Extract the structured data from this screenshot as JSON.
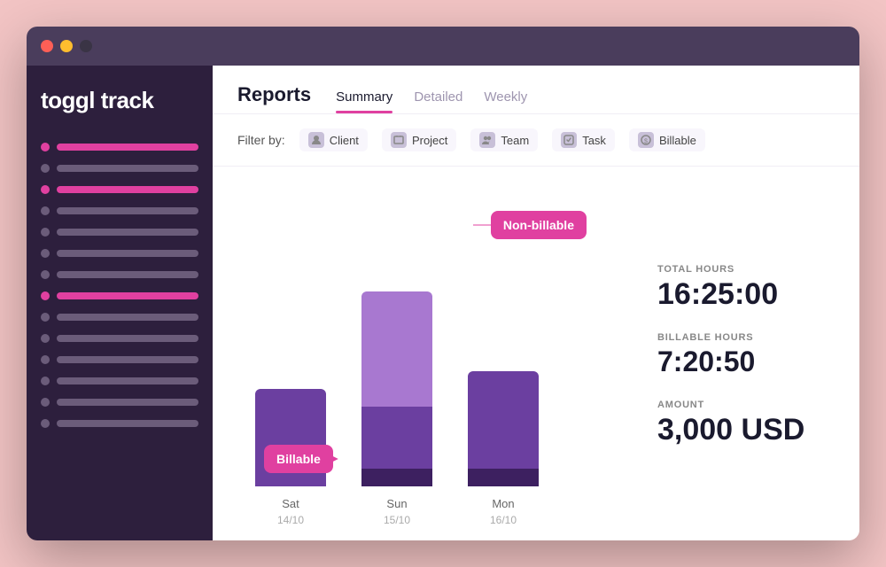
{
  "window": {
    "titlebar": {
      "btn_close": "close",
      "btn_min": "minimize",
      "btn_max": "maximize"
    }
  },
  "sidebar": {
    "logo_text1": "toggl",
    "logo_text2": " track",
    "items": [
      {
        "dot": "pink",
        "bar": "pink-long"
      },
      {
        "dot": "gray",
        "bar": "gray-xl"
      },
      {
        "dot": "pink",
        "bar": "pink-short"
      },
      {
        "dot": "gray",
        "bar": "gray-lg"
      },
      {
        "dot": "gray",
        "bar": "gray-md"
      },
      {
        "dot": "gray",
        "bar": "gray-sm"
      },
      {
        "dot": "gray",
        "bar": "gray-xs"
      },
      {
        "dot": "pink",
        "bar": "pink-short"
      },
      {
        "dot": "gray",
        "bar": "gray-xl"
      },
      {
        "dot": "gray",
        "bar": "gray-md"
      },
      {
        "dot": "gray",
        "bar": "gray-sm"
      },
      {
        "dot": "gray",
        "bar": "gray-lg"
      },
      {
        "dot": "gray",
        "bar": "gray-xs"
      },
      {
        "dot": "gray",
        "bar": "gray-md"
      }
    ]
  },
  "header": {
    "title": "Reports",
    "tabs": [
      {
        "label": "Summary",
        "active": true
      },
      {
        "label": "Detailed",
        "active": false
      },
      {
        "label": "Weekly",
        "active": false
      }
    ]
  },
  "filterbar": {
    "label": "Filter by:",
    "filters": [
      {
        "label": "Client",
        "icon": "👤"
      },
      {
        "label": "Project",
        "icon": "🗂"
      },
      {
        "label": "Team",
        "icon": "👥"
      },
      {
        "label": "Task",
        "icon": "✓"
      },
      {
        "label": "Billable",
        "icon": "$"
      }
    ]
  },
  "chart": {
    "bars": [
      {
        "day": "Sat",
        "date": "14/10",
        "billable_height": 110,
        "nonbillable_height": 0,
        "dark_height": 0
      },
      {
        "day": "Sun",
        "date": "15/10",
        "billable_height": 80,
        "nonbillable_height": 120,
        "dark_height": 20
      },
      {
        "day": "Mon",
        "date": "16/10",
        "billable_height": 60,
        "nonbillable_height": 0,
        "dark_height": 20
      }
    ],
    "tooltip_billable": "Billable",
    "tooltip_nonbillable": "Non-billable"
  },
  "stats": {
    "total_hours_label": "TOTAL HOURS",
    "total_hours_value": "16:25:00",
    "billable_hours_label": "BILLABLE HOURS",
    "billable_hours_value": "7:20:50",
    "amount_label": "AMOUNT",
    "amount_value": "3,000 USD"
  }
}
